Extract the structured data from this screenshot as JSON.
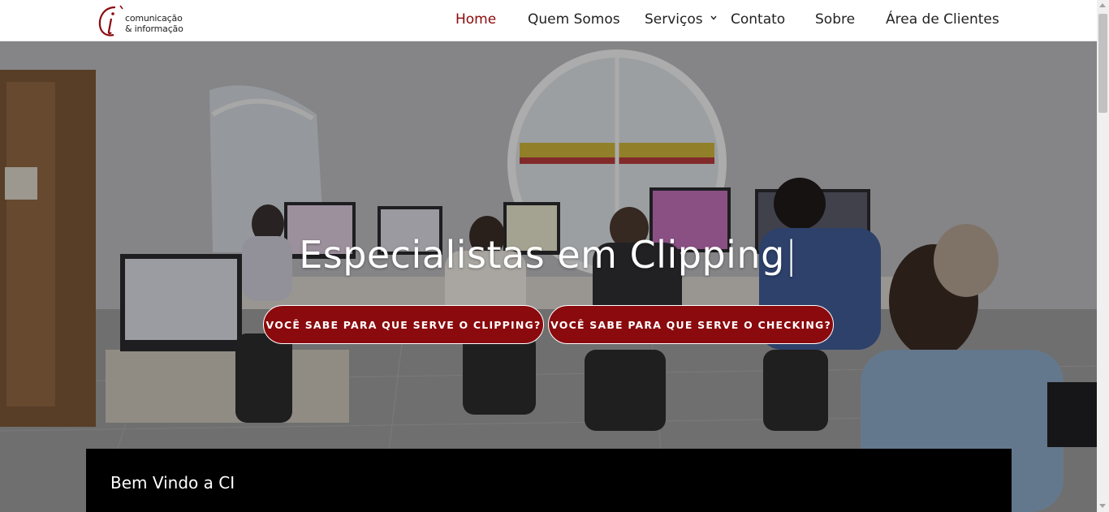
{
  "logo": {
    "line1": "comunicação",
    "line2": "& informação",
    "mark": "ci"
  },
  "nav": {
    "home": "Home",
    "quem_somos": "Quem Somos",
    "servicos": "Serviços",
    "contato": "Contato",
    "sobre": "Sobre",
    "area_clientes": "Área de Clientes"
  },
  "hero": {
    "title": "Especialistas em Clipping",
    "cursor": "|",
    "button_clipping": "VOCÊ SABE PARA QUE SERVE O CLIPPING?",
    "button_checking": "VOCÊ SABE PARA QUE SERVE O CHECKING?"
  },
  "welcome": {
    "title": "Bem Vindo a CI"
  },
  "colors": {
    "accent": "#8a0a0e",
    "nav_active": "#8a0a0a"
  }
}
